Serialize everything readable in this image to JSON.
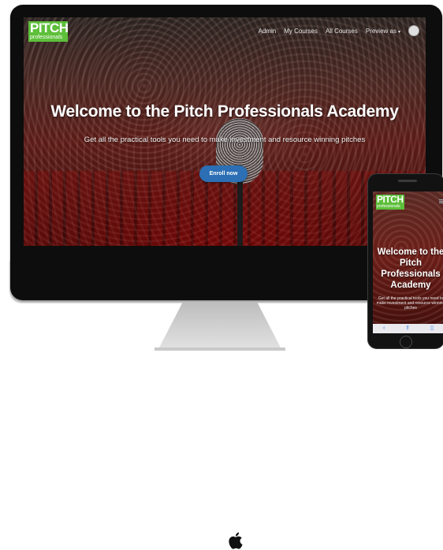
{
  "brand": {
    "line1": "PITCH",
    "line2": "professionals",
    "color": "#5dbf3a"
  },
  "nav": {
    "items": [
      "Admin",
      "My Courses",
      "All Courses",
      "Preview as"
    ],
    "avatar_icon": "user-avatar-icon"
  },
  "hero": {
    "title": "Welcome to the Pitch Professionals Academy",
    "subtitle": "Get all the practical tools you need to make investment and resource winning pitches",
    "button": "Enroll now",
    "button_color": "#2c6fb4"
  },
  "phone": {
    "title": "Welcome to the Pitch Professionals Academy",
    "subtitle": "Get all the practical tools you need to make investment and resource winning pitches",
    "browser_icons": [
      "back-icon",
      "share-icon",
      "bookmarks-icon"
    ]
  },
  "device_icons": [
    "apple-logo-icon"
  ]
}
